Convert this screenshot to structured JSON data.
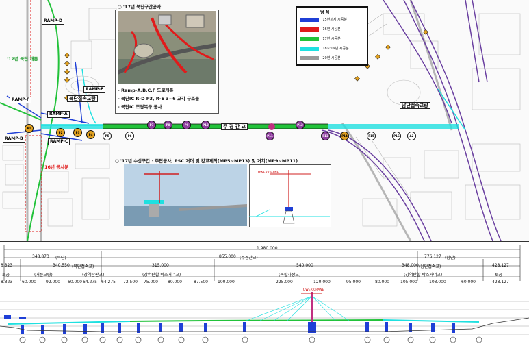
{
  "legend": {
    "title": "범 례",
    "items": [
      {
        "label": "'15년까지 시공분",
        "color": "#1f3fd6"
      },
      {
        "label": "'16년 시공분",
        "color": "#e01b1b"
      },
      {
        "label": "'17년 시공분",
        "color": "#22c23a"
      },
      {
        "label": "'18~'19년 시공분",
        "color": "#1fe0e0"
      },
      {
        "label": "'20년 시공분",
        "color": "#9a9a9a"
      }
    ]
  },
  "north": {
    "title": "○ '17년 북단구간공사",
    "notes": [
      "- Ramp-A,B,C,F 도로개통",
      "- 북단IC R-D P3, R-E 3~6 교각 구조물",
      "- 북단IC 조경복구 공사"
    ]
  },
  "river": {
    "title": "○ '17년 수상구간 : 주탑공사, PSC 거더 및 강교제작(MP5~MP13) 및 거치(MP9~MP11)",
    "drawing_label": "TOWER CRANE"
  },
  "map_labels": {
    "ramp_d": "RAMP-D",
    "ramp_e": "RAMP-E",
    "ramp_f": "RAMP-F",
    "ramp_a": "RAMP-A",
    "ramp_b": "RAMP-B",
    "ramp_c": "RAMP-C",
    "north_bridge": "북단접속교량",
    "south_bridge": "남단접속교량",
    "main_bridge": "주 경 간 교",
    "opened_17": "'17년 북단 개통",
    "opened_16": "'16년 공사분"
  },
  "piers": [
    "P1",
    "P2",
    "P3",
    "P4",
    "P5",
    "P6",
    "P7",
    "P8",
    "P9",
    "P10",
    "P11",
    "P12",
    "P13",
    "P14",
    "P15",
    "P16",
    "A2"
  ],
  "profile": {
    "total": "1,980.000",
    "top_spans": [
      {
        "value": "348.873",
        "label": "(북단)"
      },
      {
        "value": "855.000",
        "label": "(주경간교)"
      },
      {
        "value": "776.127",
        "label": "(남단)"
      }
    ],
    "mid_spans": [
      {
        "value": "8.323",
        "label": ""
      },
      {
        "value": "340.550",
        "label": "(북단접속교)"
      },
      {
        "value": "315.000",
        "label": ""
      },
      {
        "value": "540.000",
        "label": ""
      },
      {
        "value": "348.000",
        "label": "(남단접속교)"
      },
      {
        "value": "428.127",
        "label": ""
      }
    ],
    "sub_labels": [
      "토공",
      "(거푼교량)",
      "(강역탄판교)",
      "(강역탄합 박스거더교)",
      "(복합사장교)",
      "(강역탄합 박스거더교)",
      "토공"
    ],
    "spans": [
      "8.323",
      "60.000",
      "92.000",
      "60.000",
      "64.275",
      "64.275",
      "72.500",
      "75.000",
      "80.000",
      "87.500",
      "100.000",
      "225.000",
      "120.000",
      "95.000",
      "80.000",
      "105.000",
      "103.000",
      "60.000",
      "428.127"
    ],
    "tower_label": "TOWER CRANE"
  }
}
